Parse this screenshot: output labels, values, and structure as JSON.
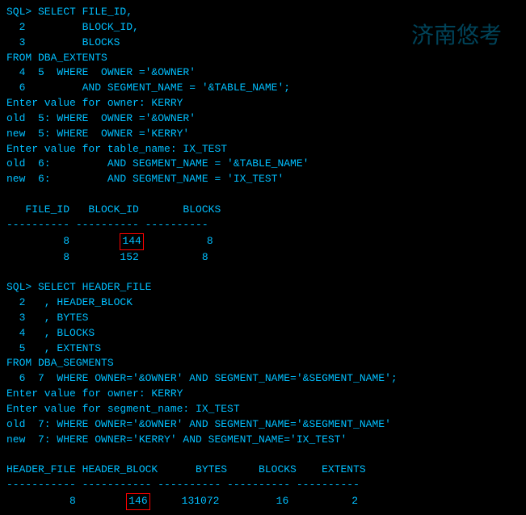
{
  "terminal": {
    "lines": [
      {
        "id": "l1",
        "text": "SQL> SELECT FILE_ID,"
      },
      {
        "id": "l2",
        "text": "  2         BLOCK_ID,"
      },
      {
        "id": "l3",
        "text": "  3         BLOCKS"
      },
      {
        "id": "l4",
        "text": "FROM DBA_EXTENTS"
      },
      {
        "id": "l5",
        "text": "  4  5  WHERE  OWNER ='&OWNER'"
      },
      {
        "id": "l6",
        "text": "  6         AND SEGMENT_NAME = '&TABLE_NAME';"
      },
      {
        "id": "l7",
        "text": "Enter value for owner: KERRY"
      },
      {
        "id": "l8",
        "text": "old  5: WHERE  OWNER ='&OWNER'"
      },
      {
        "id": "l9",
        "text": "new  5: WHERE  OWNER ='KERRY'"
      },
      {
        "id": "l10",
        "text": "Enter value for table_name: IX_TEST"
      },
      {
        "id": "l11",
        "text": "old  6:         AND SEGMENT_NAME = '&TABLE_NAME'"
      },
      {
        "id": "l12",
        "text": "new  6:         AND SEGMENT_NAME = 'IX_TEST'"
      },
      {
        "id": "l13",
        "text": ""
      },
      {
        "id": "l14",
        "text": "   FILE_ID   BLOCK_ID       BLOCKS",
        "isHeader": true
      },
      {
        "id": "l15",
        "text": "---------- ---------- ----------",
        "isSep": true
      },
      {
        "id": "l16",
        "text": "         8        ",
        "highlighted": "144",
        "rest": "          8",
        "hasHighlight": true
      },
      {
        "id": "l17",
        "text": "         8        152          8"
      },
      {
        "id": "l18",
        "text": ""
      },
      {
        "id": "l19",
        "text": "SQL> SELECT HEADER_FILE"
      },
      {
        "id": "l20",
        "text": "  2   , HEADER_BLOCK"
      },
      {
        "id": "l21",
        "text": "  3   , BYTES"
      },
      {
        "id": "l22",
        "text": "  4   , BLOCKS"
      },
      {
        "id": "l23",
        "text": "  5   , EXTENTS"
      },
      {
        "id": "l24",
        "text": "FROM DBA_SEGMENTS"
      },
      {
        "id": "l25",
        "text": "  6  7  WHERE OWNER='&OWNER' AND SEGMENT_NAME='&SEGMENT_NAME';"
      },
      {
        "id": "l26",
        "text": "Enter value for owner: KERRY"
      },
      {
        "id": "l27",
        "text": "Enter value for segment_name: IX_TEST"
      },
      {
        "id": "l28",
        "text": "old  7: WHERE OWNER='&OWNER' AND SEGMENT_NAME='&SEGMENT_NAME'"
      },
      {
        "id": "l29",
        "text": "new  7: WHERE OWNER='KERRY' AND SEGMENT_NAME='IX_TEST'"
      },
      {
        "id": "l30",
        "text": ""
      },
      {
        "id": "l31",
        "text": "HEADER_FILE HEADER_BLOCK      BYTES     BLOCKS    EXTENTS",
        "isHeader2": true
      },
      {
        "id": "l32",
        "text": "----------- ----------- ---------- ---------- ----------",
        "isSep": true
      },
      {
        "id": "l33",
        "text": "          8        ",
        "highlighted": "146",
        "rest": "     131072         16          2",
        "hasHighlight": true
      }
    ],
    "watermark": "济南悠考"
  }
}
